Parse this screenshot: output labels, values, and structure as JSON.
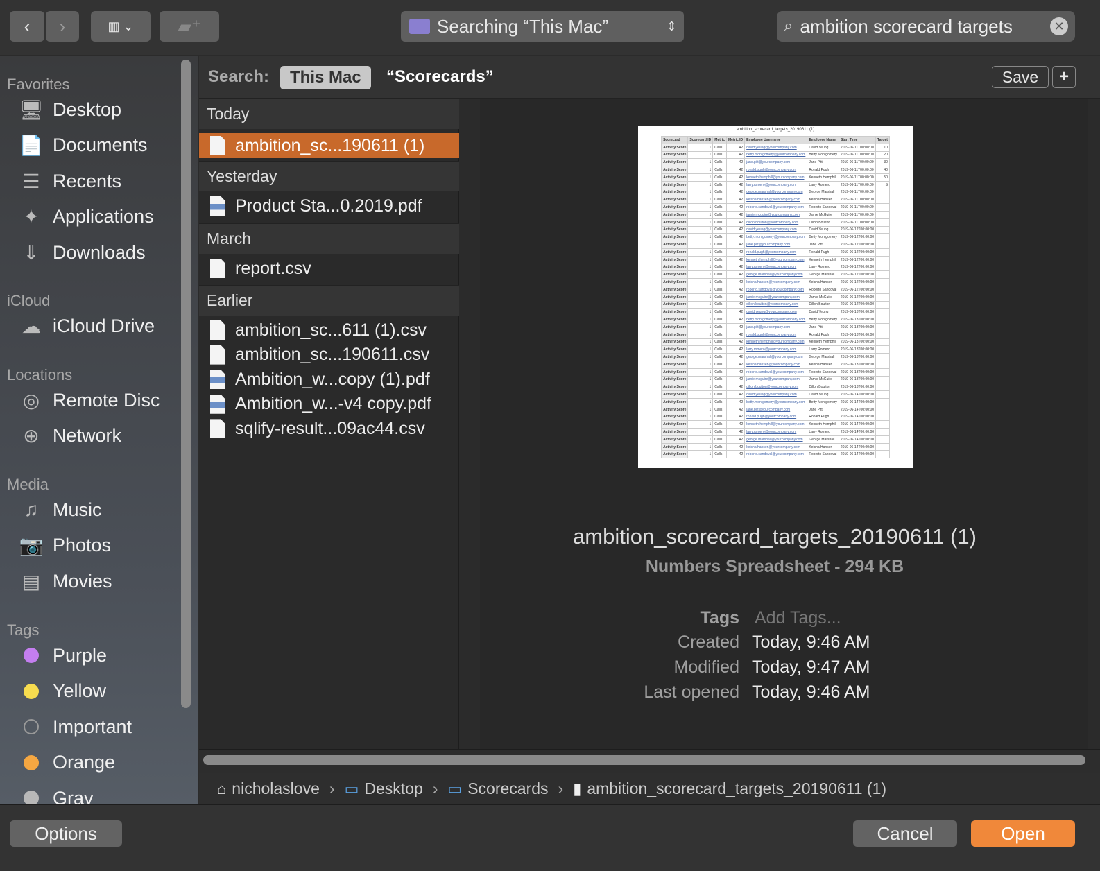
{
  "toolbar": {
    "searching_label": "Searching “This Mac”",
    "search_value": "ambition scorecard targets"
  },
  "searchbar": {
    "label": "Search:",
    "scope": "This Mac",
    "scope_alt": "“Scorecards”",
    "save": "Save",
    "add": "+"
  },
  "sidebar": {
    "favorites": "Favorites",
    "favorite_items": [
      "Desktop",
      "Documents",
      "Recents",
      "Applications",
      "Downloads"
    ],
    "icloud": "iCloud",
    "icloud_items": [
      "iCloud Drive"
    ],
    "locations": "Locations",
    "location_items": [
      "Remote Disc",
      "Network"
    ],
    "media": "Media",
    "media_items": [
      "Music",
      "Photos",
      "Movies"
    ],
    "tags": "Tags",
    "tag_items": [
      {
        "label": "Purple",
        "color": "#c47ef0"
      },
      {
        "label": "Yellow",
        "color": "#f7dc4f"
      },
      {
        "label": "Important",
        "color": "transparent"
      },
      {
        "label": "Orange",
        "color": "#f5a742"
      },
      {
        "label": "Gray",
        "color": "#b8b8b8"
      }
    ]
  },
  "list": {
    "groups": [
      "Today",
      "Yesterday",
      "March",
      "Earlier"
    ],
    "today": [
      "ambition_sc...190611 (1)"
    ],
    "yesterday": [
      "Product Sta...0.2019.pdf"
    ],
    "march": [
      "report.csv"
    ],
    "earlier": [
      "ambition_sc...611 (1).csv",
      "ambition_sc...190611.csv",
      "Ambition_w...copy (1).pdf",
      "Ambition_w...-v4 copy.pdf",
      "sqlify-result...09ac44.csv"
    ]
  },
  "preview": {
    "thumb_title": "ambition_scorecard_targets_20190611 (1)",
    "thumb_headers": [
      "Scorecard",
      "Scorecard ID",
      "Metric",
      "Metric ID",
      "Employee Username",
      "Employee Name",
      "Start Time",
      "Target"
    ],
    "thumb_users": [
      [
        "david.yeung",
        "David Yeung"
      ],
      [
        "betty.montgomery",
        "Betty Montgomery"
      ],
      [
        "jane.pitt",
        "Jane Pitt"
      ],
      [
        "ronald.pugh",
        "Ronald Pugh"
      ],
      [
        "kenneth.hemphill",
        "Kenneth Hemphill"
      ],
      [
        "larry.romero",
        "Larry Romero"
      ],
      [
        "george.marshall",
        "George Marshall"
      ],
      [
        "keisha.hansen",
        "Keisha Hansen"
      ],
      [
        "roberto.sandoval",
        "Roberto Sandoval"
      ],
      [
        "jamie.mcguire",
        "Jamie McGuire"
      ],
      [
        "dillon.boulton",
        "Dillon Boulton"
      ]
    ],
    "thumb_targets": [
      "10",
      "20",
      "30",
      "40",
      "50",
      "S"
    ],
    "thumb_dates": [
      "2019-06-11T00:00:00",
      "2019-06-12T00:00:00",
      "2019-06-13T00:00:00",
      "2019-06-14T00:00:00"
    ],
    "filename": "ambition_scorecard_targets_20190611 (1)",
    "kind": "Numbers Spreadsheet - 294 KB",
    "tags_label": "Tags",
    "tags_placeholder": "Add Tags...",
    "created_label": "Created",
    "created": "Today, 9:46 AM",
    "modified_label": "Modified",
    "modified": "Today, 9:47 AM",
    "opened_label": "Last opened",
    "opened": "Today, 9:46 AM"
  },
  "path": [
    "nicholaslove",
    "Desktop",
    "Scorecards",
    "ambition_scorecard_targets_20190611 (1)"
  ],
  "buttons": {
    "options": "Options",
    "cancel": "Cancel",
    "open": "Open"
  },
  "colors": {
    "accent": "#f0883a",
    "selection": "#c8692b"
  }
}
